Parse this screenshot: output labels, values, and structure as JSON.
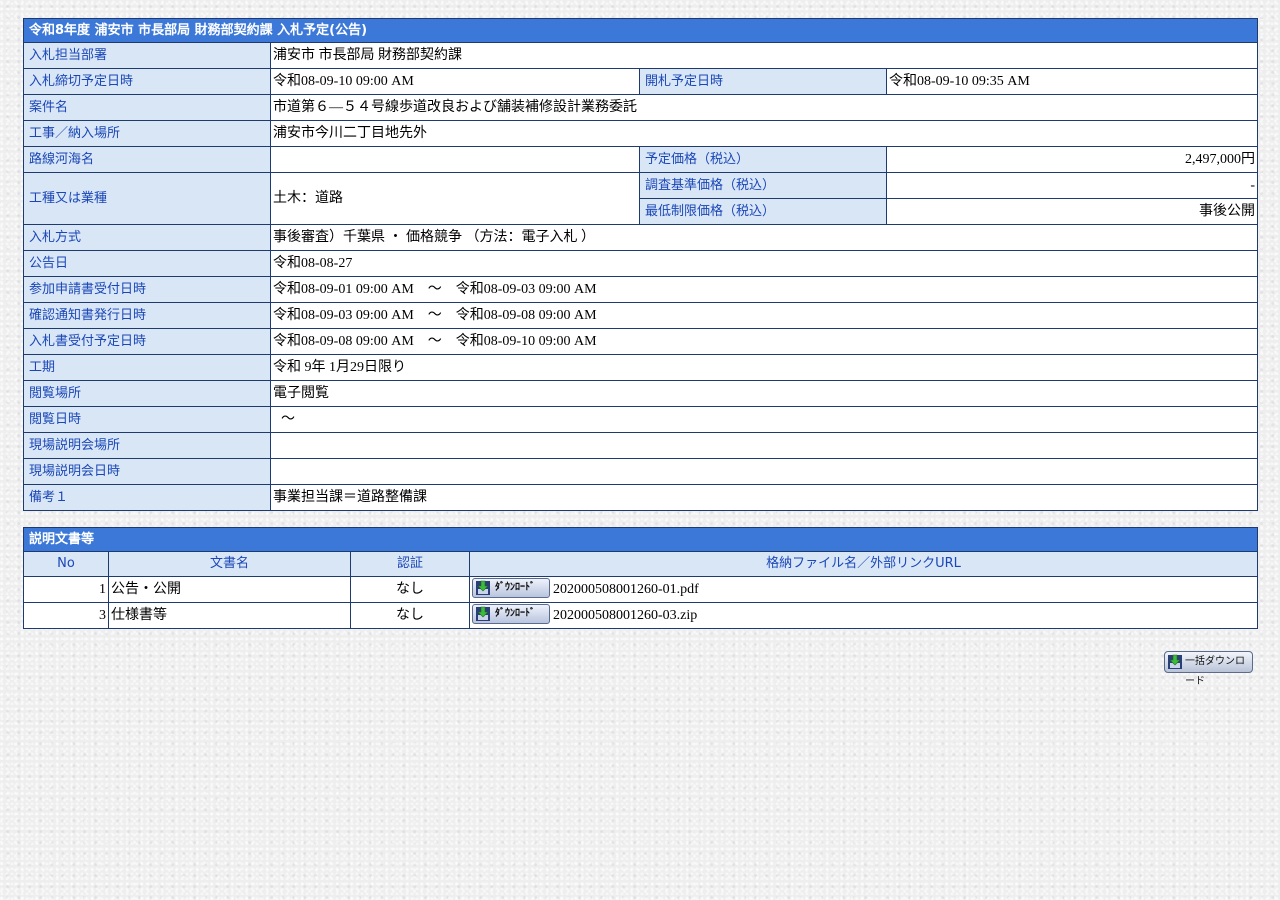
{
  "notice": {
    "title": "令和8年度 浦安市 市長部局 財務部契約課 入札予定(公告)",
    "rows": {
      "dept_label": "入札担当部署",
      "dept_value": "浦安市 市長部局 財務部契約課",
      "deadline_label": "入札締切予定日時",
      "deadline_value": "令和08-09-10 09:00 AM",
      "opening_label": "開札予定日時",
      "opening_value": "令和08-09-10 09:35 AM",
      "case_label": "案件名",
      "case_value": "市道第６―５４号線歩道改良および舗装補修設計業務委託",
      "place_label": "工事／納入場所",
      "place_value": "浦安市今川二丁目地先外",
      "route_label": "路線河海名",
      "route_value": "",
      "est_price_label": "予定価格（税込）",
      "est_price_value": "2,497,000円",
      "type_label": "工種又は業種",
      "type_value": "土木：道路",
      "survey_price_label": "調査基準価格（税込）",
      "survey_price_value": "-",
      "min_price_label": "最低制限価格（税込）",
      "min_price_value": "事後公開",
      "method_label": "入札方式",
      "method_value": "事後審査）千葉県 ・ 価格競争 （方法：電子入札 ）",
      "announce_label": "公告日",
      "announce_value": "令和08-08-27",
      "apply_label": "参加申請書受付日時",
      "apply_value": "令和08-09-01 09:00 AM　～　令和08-09-03 09:00 AM",
      "confirm_label": "確認通知書発行日時",
      "confirm_value": "令和08-09-03 09:00 AM　～　令和08-09-08 09:00 AM",
      "bid_receive_label": "入札書受付予定日時",
      "bid_receive_value": "令和08-09-08 09:00 AM　～　令和08-09-10 09:00 AM",
      "period_label": "工期",
      "period_value": "令和 9年 1月29日限り",
      "view_place_label": "閲覧場所",
      "view_place_value": "電子閲覧",
      "view_date_label": "閲覧日時",
      "view_date_value": "～",
      "briefing_place_label": "現場説明会場所",
      "briefing_place_value": "",
      "briefing_date_label": "現場説明会日時",
      "briefing_date_value": "",
      "remarks_label": "備考１",
      "remarks_value": "事業担当課＝道路整備課"
    }
  },
  "documents": {
    "title": "説明文書等",
    "headers": {
      "no": "No",
      "name": "文書名",
      "auth": "認証",
      "file": "格納ファイル名／外部リンクURL"
    },
    "download_label": "ﾀﾞｳﾝﾛｰﾄﾞ",
    "items": [
      {
        "no": "1",
        "name": "公告・公開",
        "auth": "なし",
        "file": "202000508001260-01.pdf"
      },
      {
        "no": "3",
        "name": "仕様書等",
        "auth": "なし",
        "file": "202000508001260-03.zip"
      }
    ]
  },
  "bulk_download_label": "一括ダウンロード",
  "colors": {
    "header_bg": "#3c78d8",
    "label_bg": "#d9e6f5",
    "label_text": "#1a47b8",
    "border": "#1f3a6e"
  },
  "icons": [
    "download-icon"
  ]
}
